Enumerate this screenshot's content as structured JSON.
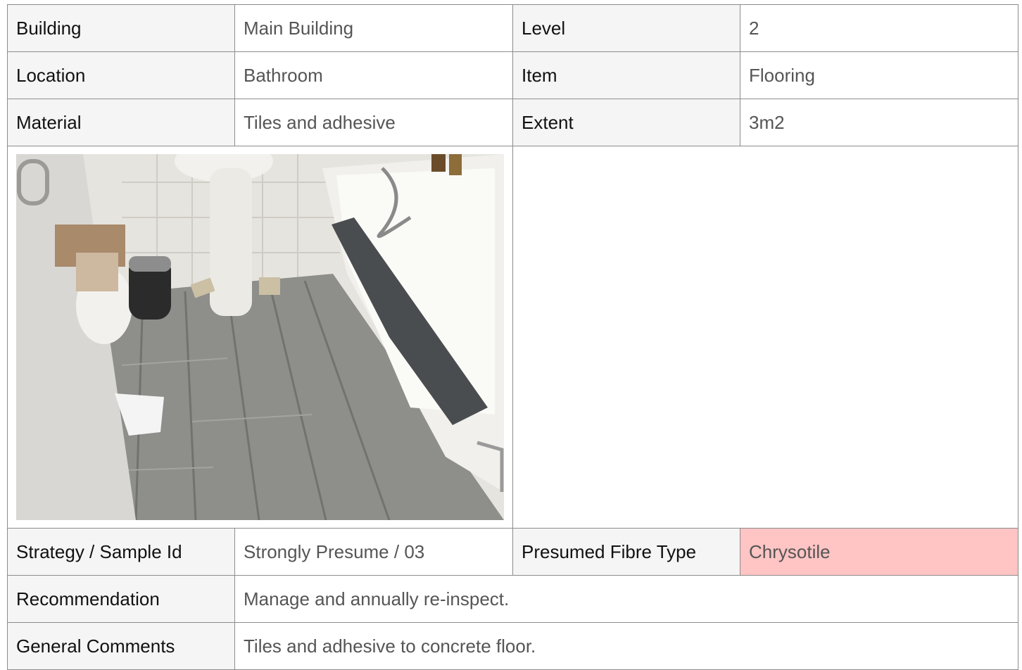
{
  "rows": {
    "building": {
      "label": "Building",
      "value": "Main Building"
    },
    "level": {
      "label": "Level",
      "value": "2"
    },
    "location": {
      "label": "Location",
      "value": "Bathroom"
    },
    "item": {
      "label": "Item",
      "value": "Flooring"
    },
    "material": {
      "label": "Material",
      "value": "Tiles and adhesive"
    },
    "extent": {
      "label": "Extent",
      "value": "3m2"
    },
    "strategy": {
      "label": "Strategy / Sample Id",
      "value": "Strongly Presume / 03"
    },
    "fibre": {
      "label": "Presumed Fibre Type",
      "value": "Chrysotile",
      "highlight_color": "#ffc4c4"
    },
    "recommendation": {
      "label": "Recommendation",
      "value": "Manage and annually re-inspect."
    },
    "comments": {
      "label": "General Comments",
      "value": "Tiles and adhesive to concrete floor."
    }
  },
  "photo": {
    "icon": "bathroom-photo",
    "colors": {
      "floor": "#8e8e8a",
      "tile": "#e9e7e2",
      "towel": "#4a4d4f",
      "bath": "#f1f0ec"
    }
  }
}
